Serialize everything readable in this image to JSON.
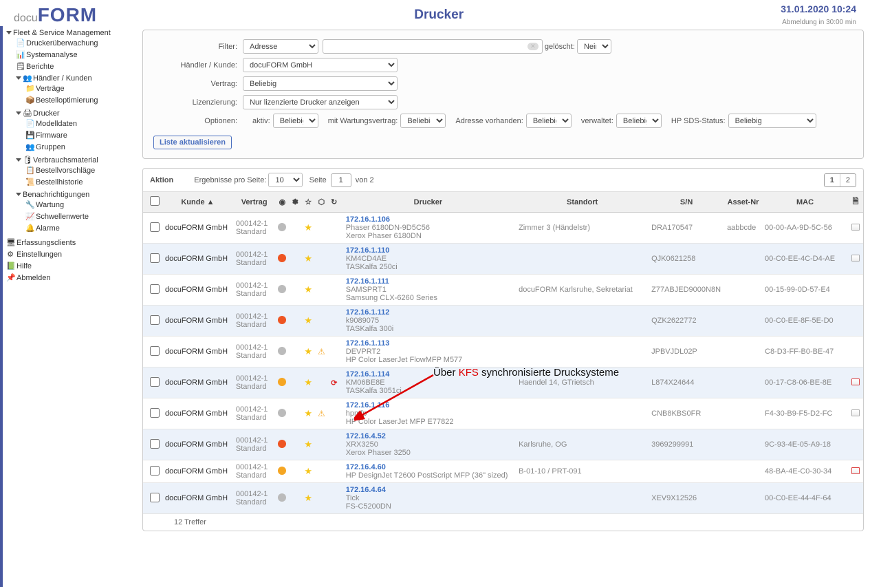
{
  "header": {
    "logo_small": "docu",
    "logo_big": "FORM",
    "title": "Drucker",
    "datetime": "31.01.2020 10:24",
    "session": "Abmeldung in 30:00 min"
  },
  "tree": {
    "root": "Fleet & Service Management",
    "printer_monitoring": "Druckerüberwachung",
    "system_analysis": "Systemanalyse",
    "reports": "Berichte",
    "dealer_customers": "Händler / Kunden",
    "contracts": "Verträge",
    "order_opt": "Bestelloptimierung",
    "printers": "Drucker",
    "model_data": "Modelldaten",
    "firmware": "Firmware",
    "groups": "Gruppen",
    "consumables": "Verbrauchsmaterial",
    "order_suggestions": "Bestellvorschläge",
    "order_history": "Bestellhistorie",
    "notifications": "Benachrichtigungen",
    "maintenance": "Wartung",
    "thresholds": "Schwellenwerte",
    "alarms": "Alarme",
    "capture_clients": "Erfassungsclients",
    "settings": "Einstellungen",
    "help": "Hilfe",
    "logout": "Abmelden"
  },
  "filters": {
    "filter_label": "Filter:",
    "filter_sel": "Adresse",
    "search": "",
    "deleted_label": "gelöscht:",
    "deleted_val": "Nein",
    "dealer_label": "Händler / Kunde:",
    "dealer_val": "docuFORM GmbH",
    "contract_label": "Vertrag:",
    "contract_val": "Beliebig",
    "lic_label": "Lizenzierung:",
    "lic_val": "Nur lizenzierte Drucker anzeigen",
    "opt_label": "Optionen:",
    "active_label": "aktiv:",
    "wart_label": "mit Wartungsvertrag:",
    "addr_label": "Adresse vorhanden:",
    "managed_label": "verwaltet:",
    "sds_label": "HP SDS-Status:",
    "beliebig": "Beliebig",
    "refresh": "Liste aktualisieren"
  },
  "table": {
    "action": "Aktion",
    "results_per_page_label": "Ergebnisse pro Seite:",
    "results_per_page": "10",
    "page_label": "Seite",
    "page_num": "1",
    "page_of": "von 2",
    "p1": "1",
    "p2": "2",
    "h_kunde": "Kunde",
    "h_vertrag": "Vertrag",
    "h_drucker": "Drucker",
    "h_standort": "Standort",
    "h_sn": "S/N",
    "h_asset": "Asset-Nr",
    "h_mac": "MAC",
    "footer": "12 Treffer"
  },
  "rows": [
    {
      "kunde": "docuFORM GmbH",
      "vertrag": "000142-1",
      "vstd": "Standard",
      "dot": "grey",
      "star": true,
      "warn": false,
      "sync": false,
      "ip": "172.16.1.106",
      "host": "Phaser 6180DN-9D5C56",
      "model": "Xerox Phaser 6180DN",
      "standort": "Zimmer 3 (Händelstr)",
      "sn": "DRA170547",
      "asset": "aabbcde",
      "mac": "00-00-AA-9D-5C-56",
      "end": "doc"
    },
    {
      "kunde": "docuFORM GmbH",
      "vertrag": "000142-1",
      "vstd": "Standard",
      "dot": "red",
      "star": true,
      "warn": false,
      "sync": false,
      "ip": "172.16.1.110",
      "host": "KM4CD4AE",
      "model": "TASKalfa 250ci",
      "standort": "",
      "sn": "QJK0621258",
      "asset": "",
      "mac": "00-C0-EE-4C-D4-AE",
      "end": "doc"
    },
    {
      "kunde": "docuFORM GmbH",
      "vertrag": "000142-1",
      "vstd": "Standard",
      "dot": "grey",
      "star": true,
      "warn": false,
      "sync": false,
      "ip": "172.16.1.111",
      "host": "SAMSPRT1",
      "model": "Samsung CLX-6260 Series",
      "standort": "docuFORM Karlsruhe, Sekretariat",
      "sn": "Z77ABJED9000N8N",
      "asset": "",
      "mac": "00-15-99-0D-57-E4",
      "end": ""
    },
    {
      "kunde": "docuFORM GmbH",
      "vertrag": "000142-1",
      "vstd": "Standard",
      "dot": "red",
      "star": true,
      "warn": false,
      "sync": false,
      "ip": "172.16.1.112",
      "host": "k9089075",
      "model": "TASKalfa 300i",
      "standort": "",
      "sn": "QZK2622772",
      "asset": "",
      "mac": "00-C0-EE-8F-5E-D0",
      "end": ""
    },
    {
      "kunde": "docuFORM GmbH",
      "vertrag": "000142-1",
      "vstd": "Standard",
      "dot": "grey",
      "star": true,
      "warn": true,
      "sync": false,
      "ip": "172.16.1.113",
      "host": "DEVPRT2",
      "model": "HP Color LaserJet FlowMFP M577",
      "standort": "",
      "sn": "JPBVJDL02P",
      "asset": "",
      "mac": "C8-D3-FF-B0-BE-47",
      "end": ""
    },
    {
      "kunde": "docuFORM GmbH",
      "vertrag": "000142-1",
      "vstd": "Standard",
      "dot": "orange",
      "star": true,
      "warn": false,
      "sync": true,
      "ip": "172.16.1.114",
      "host": "KM06BE8E",
      "model": "TASKalfa 3051ci",
      "standort": "Haendel 14, GTrietsch",
      "sn": "L874X24644",
      "asset": "",
      "mac": "00-17-C8-06-BE-8E",
      "end": "red"
    },
    {
      "kunde": "docuFORM GmbH",
      "vertrag": "000142-1",
      "vstd": "Standard",
      "dot": "grey",
      "star": true,
      "warn": true,
      "sync": false,
      "ip": "172.16.1.116",
      "host": "hpmfp",
      "model": "HP Color LaserJet MFP E77822",
      "standort": "",
      "sn": "CNB8KBS0FR",
      "asset": "",
      "mac": "F4-30-B9-F5-D2-FC",
      "end": "doc"
    },
    {
      "kunde": "docuFORM GmbH",
      "vertrag": "000142-1",
      "vstd": "Standard",
      "dot": "red",
      "star": true,
      "warn": false,
      "sync": false,
      "ip": "172.16.4.52",
      "host": "XRX3250",
      "model": "Xerox Phaser 3250",
      "standort": "Karlsruhe, OG",
      "sn": "3969299991",
      "asset": "",
      "mac": "9C-93-4E-05-A9-18",
      "end": ""
    },
    {
      "kunde": "docuFORM GmbH",
      "vertrag": "000142-1",
      "vstd": "Standard",
      "dot": "orange",
      "star": true,
      "warn": false,
      "sync": false,
      "ip": "172.16.4.60",
      "host": "HP DesignJet T2600 PostScript MFP (36\" sized)",
      "model": "",
      "standort": "B-01-10 / PRT-091",
      "sn": "",
      "asset": "",
      "mac": "48-BA-4E-C0-30-34",
      "end": "red"
    },
    {
      "kunde": "docuFORM GmbH",
      "vertrag": "000142-1",
      "vstd": "Standard",
      "dot": "grey",
      "star": true,
      "warn": false,
      "sync": false,
      "ip": "172.16.4.64",
      "host": "Tick",
      "model": "FS-C5200DN",
      "standort": "",
      "sn": "XEV9X12526",
      "asset": "",
      "mac": "00-C0-EE-44-4F-64",
      "end": ""
    }
  ],
  "annotation": {
    "pre": "Über ",
    "kfs": "KFS",
    "post": " synchronisierte Drucksysteme"
  }
}
